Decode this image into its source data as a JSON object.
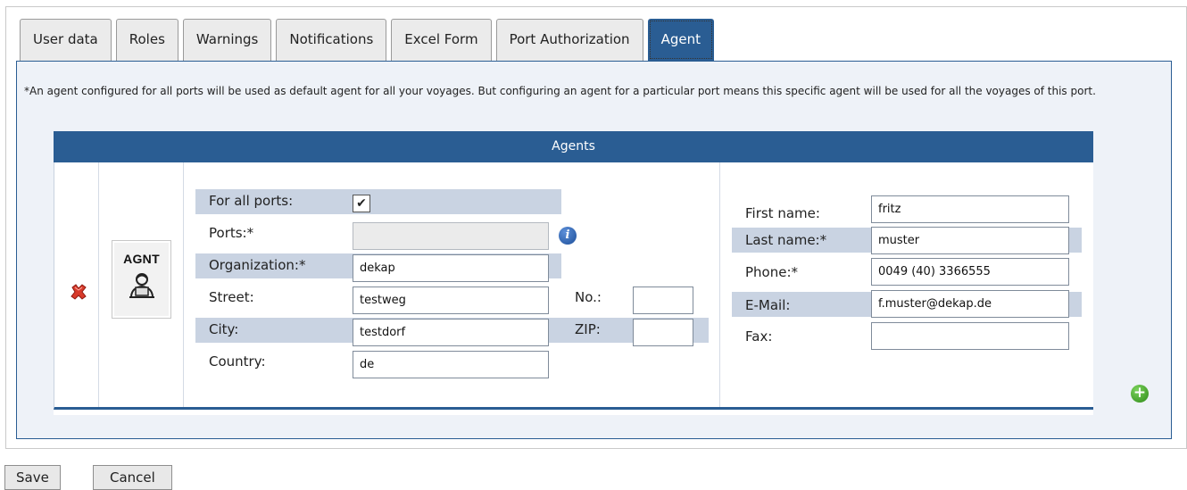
{
  "tabs": [
    {
      "label": "User data"
    },
    {
      "label": "Roles"
    },
    {
      "label": "Warnings"
    },
    {
      "label": "Notifications"
    },
    {
      "label": "Excel Form"
    },
    {
      "label": "Port Authorization"
    },
    {
      "label": "Agent",
      "active": true
    }
  ],
  "note": "*An agent configured for all ports will be used as default agent for all your voyages. But configuring an agent for a particular port means this specific agent will be used for all the voyages of this port.",
  "agents": {
    "header": "Agents",
    "image_code": "AGNT",
    "labels": {
      "for_all_ports": "For all ports:",
      "ports": "Ports:*",
      "organization": "Organization:*",
      "street": "Street:",
      "no": "No.:",
      "city": "City:",
      "zip": "ZIP:",
      "country": "Country:",
      "first_name": "First name:",
      "last_name": "Last name:*",
      "phone": "Phone:*",
      "email": "E-Mail:",
      "fax": "Fax:"
    },
    "values": {
      "for_all_ports_checked": true,
      "ports": "",
      "organization": "dekap",
      "street": "testweg",
      "no": "",
      "city": "testdorf",
      "zip": "",
      "country": "de",
      "first_name": "fritz",
      "last_name": "muster",
      "phone": "0049 (40) 3366555",
      "email": "f.muster@dekap.de",
      "fax": ""
    },
    "icons": {
      "delete": "delete-icon",
      "info": "info-icon",
      "add": "add-icon",
      "agent": "agent-person-icon"
    }
  },
  "buttons": {
    "save": "Save",
    "cancel": "Cancel"
  },
  "colors": {
    "accent": "#2a5d93",
    "panel": "#eef2f8",
    "band": "#c9d3e2"
  }
}
